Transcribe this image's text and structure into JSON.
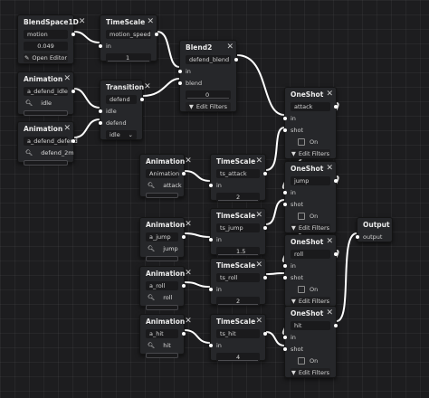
{
  "nodes": {
    "blendspace": {
      "title": "BlendSpace1D",
      "param": "motion",
      "value": "0.049",
      "button": "Open Editor"
    },
    "timescale_top": {
      "title": "TimeScale",
      "param": "motion_speed",
      "in": "in",
      "value": "1"
    },
    "blend2": {
      "title": "Blend2",
      "param": "defend_blend",
      "in": "in",
      "blend": "blend",
      "value": "0",
      "button": "Edit Filters"
    },
    "anim_idle": {
      "title": "Animation",
      "param": "a_defend_idle",
      "anim": "idle"
    },
    "anim_defend": {
      "title": "Animation",
      "param": "a_defend_defend",
      "anim": "defend_2m"
    },
    "transition": {
      "title": "Transition",
      "param": "defend",
      "in1": "idle",
      "in2": "defend",
      "select": "idle"
    },
    "anim_attack": {
      "title": "Animation",
      "param": "Animation",
      "anim": "attack"
    },
    "ts_attack": {
      "title": "TimeScale",
      "param": "ts_attack",
      "in": "in",
      "value": "2"
    },
    "oneshot1": {
      "title": "OneShot",
      "param": "attack",
      "in": "in",
      "shot": "shot",
      "on": "On",
      "button": "Edit Filters"
    },
    "oneshot2": {
      "title": "OneShot",
      "param": "jump",
      "in": "in",
      "shot": "shot",
      "on": "On",
      "button": "Edit Filters"
    },
    "anim_jump": {
      "title": "Animation",
      "param": "a_jump",
      "anim": "jump"
    },
    "ts_jump": {
      "title": "TimeScale",
      "param": "ts_jump",
      "in": "in",
      "value": "1.5"
    },
    "oneshot3": {
      "title": "OneShot",
      "param": "roll",
      "in": "in",
      "shot": "shot",
      "on": "On",
      "button": "Edit Filters"
    },
    "anim_roll": {
      "title": "Animation",
      "param": "a_roll",
      "anim": "roll"
    },
    "ts_roll": {
      "title": "TimeScale",
      "param": "ts_roll",
      "in": "in",
      "value": "2"
    },
    "oneshot4": {
      "title": "OneShot",
      "param": "hit",
      "in": "in",
      "shot": "shot",
      "on": "On",
      "button": "Edit Filters"
    },
    "anim_hit": {
      "title": "Animation",
      "param": "a_hit",
      "anim": "hit"
    },
    "ts_hit": {
      "title": "TimeScale",
      "param": "ts_hit",
      "in": "in",
      "value": "4"
    },
    "output": {
      "title": "Output",
      "param": "output"
    }
  },
  "icons": {
    "close": "close-icon",
    "search": "magnifier-icon",
    "filter": "filter-icon",
    "editor": "editor-icon",
    "dropdown": "chevron-down-icon"
  },
  "colors": {
    "canvas": "#1d1d1f",
    "node": "#26272a",
    "wire": "#ffffff"
  }
}
